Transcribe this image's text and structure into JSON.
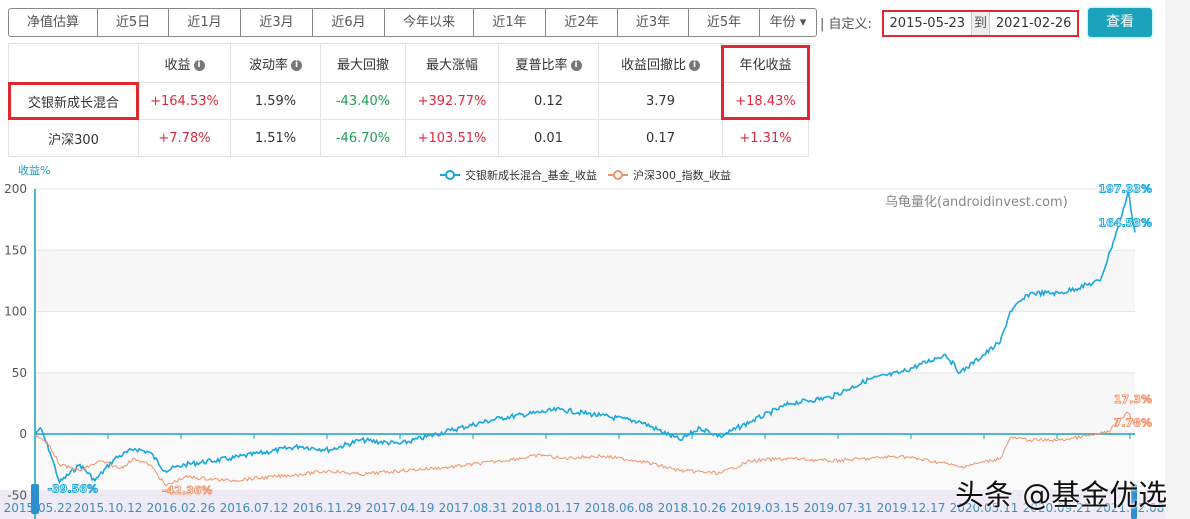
{
  "range_buttons": [
    "净值估算",
    "近5日",
    "近1月",
    "近3月",
    "近6月",
    "今年以来",
    "近1年",
    "近2年",
    "近3年",
    "近5年",
    "年份 ▾"
  ],
  "custom_label": "|  自定义:",
  "start_date": "2015-05-23",
  "to_label": "到",
  "end_date": "2021-02-26",
  "query_button": "查看",
  "table": {
    "headers": [
      "",
      "收益",
      "波动率",
      "最大回撤",
      "最大涨幅",
      "夏普比率",
      "收益回撤比",
      "年化收益"
    ],
    "info_cols": [
      1,
      2,
      5,
      6
    ],
    "rows": [
      [
        "交银新成长混合",
        "+164.53%",
        "1.59%",
        "-43.40%",
        "+392.77%",
        "0.12",
        "3.79",
        "+18.43%"
      ],
      [
        "沪深300",
        "+7.78%",
        "1.51%",
        "-46.70%",
        "+103.51%",
        "0.01",
        "0.17",
        "+1.31%"
      ]
    ]
  },
  "watermark_chart": "乌龟量化(androidinvest.com)",
  "watermark_page": "头条 @基金优选",
  "colors": {
    "fund": "#1aa7dc",
    "index": "#f0936a",
    "accent": "#1aa3ba",
    "highlight": "#e0282d"
  },
  "chart_data": {
    "type": "line",
    "ylabel": "收益%",
    "ylim": [
      -50,
      200
    ],
    "yticks": [
      -50,
      0,
      50,
      100,
      150,
      200
    ],
    "xlim": [
      "2015-05-22",
      "2021-02-26"
    ],
    "xticks": [
      "2015.05.22",
      "2015.10.12",
      "2016.02.26",
      "2016.07.12",
      "2016.11.29",
      "2017.04.19",
      "2017.08.31",
      "2018.01.17",
      "2018.06.08",
      "2018.10.26",
      "2019.03.15",
      "2019.07.31",
      "2019.12.17",
      "2020.05.11",
      "2020.09.21",
      "2021.02.08"
    ],
    "legend": "top-center",
    "series": [
      {
        "name": "交银新成长混合_基金_收益",
        "color": "#1aa7dc",
        "points": [
          [
            "2015-05-22",
            0
          ],
          [
            "2015-06-01",
            5
          ],
          [
            "2015-06-20",
            -15
          ],
          [
            "2015-07-08",
            -39.56
          ],
          [
            "2015-08-16",
            -25
          ],
          [
            "2015-09-14",
            -38
          ],
          [
            "2015-10-22",
            -20
          ],
          [
            "2015-11-29",
            -12
          ],
          [
            "2015-12-28",
            -15
          ],
          [
            "2016-01-26",
            -30
          ],
          [
            "2016-03-04",
            -25
          ],
          [
            "2016-05-29",
            -20
          ],
          [
            "2016-10-10",
            -10
          ],
          [
            "2016-12-07",
            -13
          ],
          [
            "2017-02-03",
            -5
          ],
          [
            "2017-04-21",
            -8
          ],
          [
            "2017-07-26",
            3
          ],
          [
            "2017-10-29",
            13
          ],
          [
            "2018-02-21",
            20
          ],
          [
            "2018-05-09",
            15
          ],
          [
            "2018-07-25",
            10
          ],
          [
            "2018-10-09",
            -5
          ],
          [
            "2018-11-16",
            5
          ],
          [
            "2018-12-25",
            -2
          ],
          [
            "2019-02-20",
            10
          ],
          [
            "2019-05-08",
            25
          ],
          [
            "2019-07-23",
            30
          ],
          [
            "2019-10-08",
            45
          ],
          [
            "2019-12-04",
            50
          ],
          [
            "2020-02-29",
            65
          ],
          [
            "2020-03-28",
            50
          ],
          [
            "2020-06-13",
            75
          ],
          [
            "2020-07-02",
            100
          ],
          [
            "2020-08-09",
            115
          ],
          [
            "2020-10-06",
            115
          ],
          [
            "2020-12-21",
            125
          ],
          [
            "2021-01-10",
            150
          ],
          [
            "2021-01-29",
            175
          ],
          [
            "2021-02-13",
            197.33
          ],
          [
            "2021-02-26",
            164.53
          ]
        ],
        "labels": [
          {
            "date": "2015-07-08",
            "text": "-39.56%"
          },
          {
            "date": "2021-02-13",
            "text": "197.33%"
          },
          {
            "date": "2021-02-26",
            "text": "164.53%"
          }
        ]
      },
      {
        "name": "沪深300_指数_收益",
        "color": "#f0936a",
        "points": [
          [
            "2015-05-22",
            0
          ],
          [
            "2015-06-20",
            -10
          ],
          [
            "2015-07-08",
            -25
          ],
          [
            "2015-08-16",
            -30
          ],
          [
            "2015-09-24",
            -22
          ],
          [
            "2015-11-01",
            -28
          ],
          [
            "2015-11-29",
            -20
          ],
          [
            "2015-12-28",
            -25
          ],
          [
            "2016-01-28",
            -42.36
          ],
          [
            "2016-03-04",
            -35
          ],
          [
            "2016-05-29",
            -38
          ],
          [
            "2016-10-10",
            -33
          ],
          [
            "2016-12-07",
            -30
          ],
          [
            "2017-02-03",
            -33
          ],
          [
            "2017-04-21",
            -30
          ],
          [
            "2017-07-26",
            -27
          ],
          [
            "2017-10-29",
            -22
          ],
          [
            "2018-01-20",
            -17
          ],
          [
            "2018-02-21",
            -20
          ],
          [
            "2018-05-09",
            -18
          ],
          [
            "2018-07-25",
            -22
          ],
          [
            "2018-10-09",
            -30
          ],
          [
            "2018-12-25",
            -32
          ],
          [
            "2019-02-20",
            -22
          ],
          [
            "2019-05-08",
            -20
          ],
          [
            "2019-07-23",
            -22
          ],
          [
            "2019-10-08",
            -20
          ],
          [
            "2019-12-04",
            -18
          ],
          [
            "2020-02-29",
            -24
          ],
          [
            "2020-03-28",
            -27
          ],
          [
            "2020-06-13",
            -20
          ],
          [
            "2020-07-02",
            -3
          ],
          [
            "2020-08-09",
            -5
          ],
          [
            "2020-10-06",
            -5
          ],
          [
            "2020-12-21",
            0
          ],
          [
            "2021-01-10",
            3
          ],
          [
            "2021-01-29",
            13
          ],
          [
            "2021-02-13",
            17.3
          ],
          [
            "2021-02-26",
            7.78
          ]
        ],
        "labels": [
          {
            "date": "2016-01-28",
            "text": "-42.36%"
          },
          {
            "date": "2021-02-13",
            "text": "17.3%"
          },
          {
            "date": "2021-02-26",
            "text": "7.78%"
          }
        ]
      }
    ]
  }
}
